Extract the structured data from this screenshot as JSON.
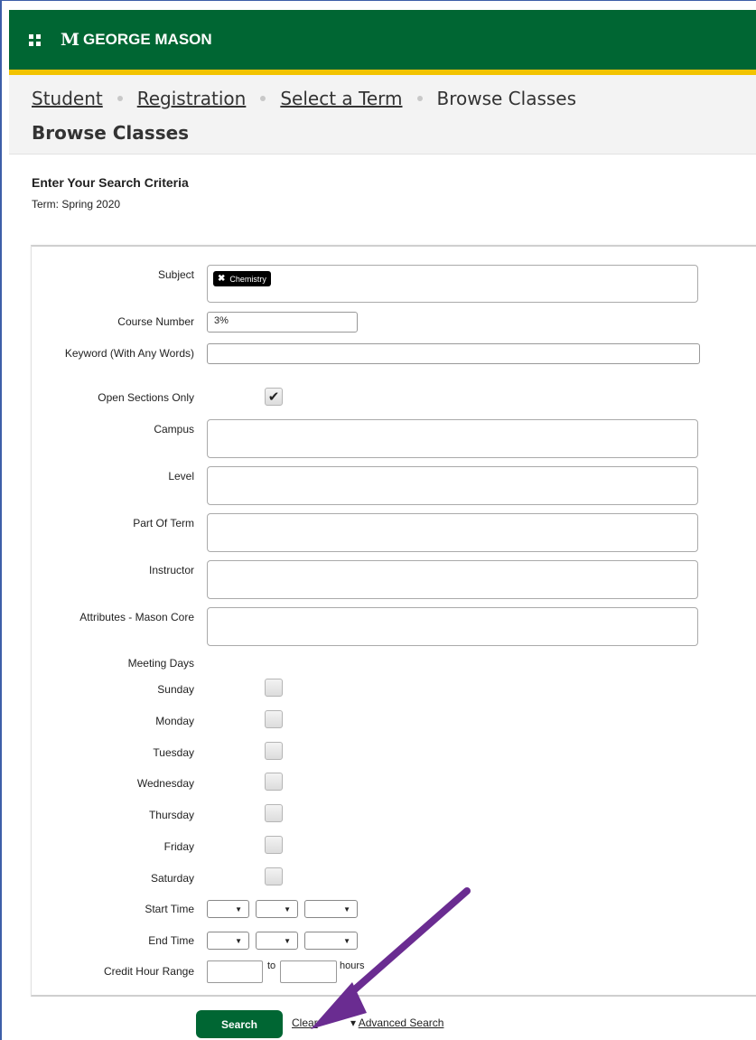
{
  "header": {
    "logo_mark": "M",
    "logo_text": "GEORGE MASON",
    "grid_icon": "apps-grid-icon",
    "brand_green": "#006633",
    "brand_gold": "#f2c300"
  },
  "breadcrumb": {
    "items": [
      "Student",
      "Registration",
      "Select a Term"
    ],
    "current": "Browse Classes"
  },
  "page": {
    "title": "Browse Classes"
  },
  "criteria": {
    "heading": "Enter Your Search Criteria",
    "term_label": "Term: Spring 2020"
  },
  "form": {
    "subject_label": "Subject",
    "subject_chip": "Chemistry",
    "course_number_label": "Course Number",
    "course_number_value": "3%",
    "keyword_label": "Keyword (With Any Words)",
    "keyword_value": "",
    "open_sections_label": "Open Sections Only",
    "open_sections_checked": true,
    "campus_label": "Campus",
    "level_label": "Level",
    "part_of_term_label": "Part Of Term",
    "instructor_label": "Instructor",
    "attributes_label": "Attributes - Mason Core",
    "meeting_days_label": "Meeting Days",
    "days": [
      "Sunday",
      "Monday",
      "Tuesday",
      "Wednesday",
      "Thursday",
      "Friday",
      "Saturday"
    ],
    "start_time_label": "Start Time",
    "end_time_label": "End Time",
    "credit_hour_label": "Credit Hour Range",
    "to_label": "to",
    "hours_label": "hours",
    "dropdown_arrow": "▼"
  },
  "actions": {
    "search_label": "Search",
    "clear_label": "Clear",
    "advanced_label": "Advanced Search",
    "advanced_icon": "▾"
  },
  "annotation": {
    "arrow_color": "#6a2c91"
  }
}
